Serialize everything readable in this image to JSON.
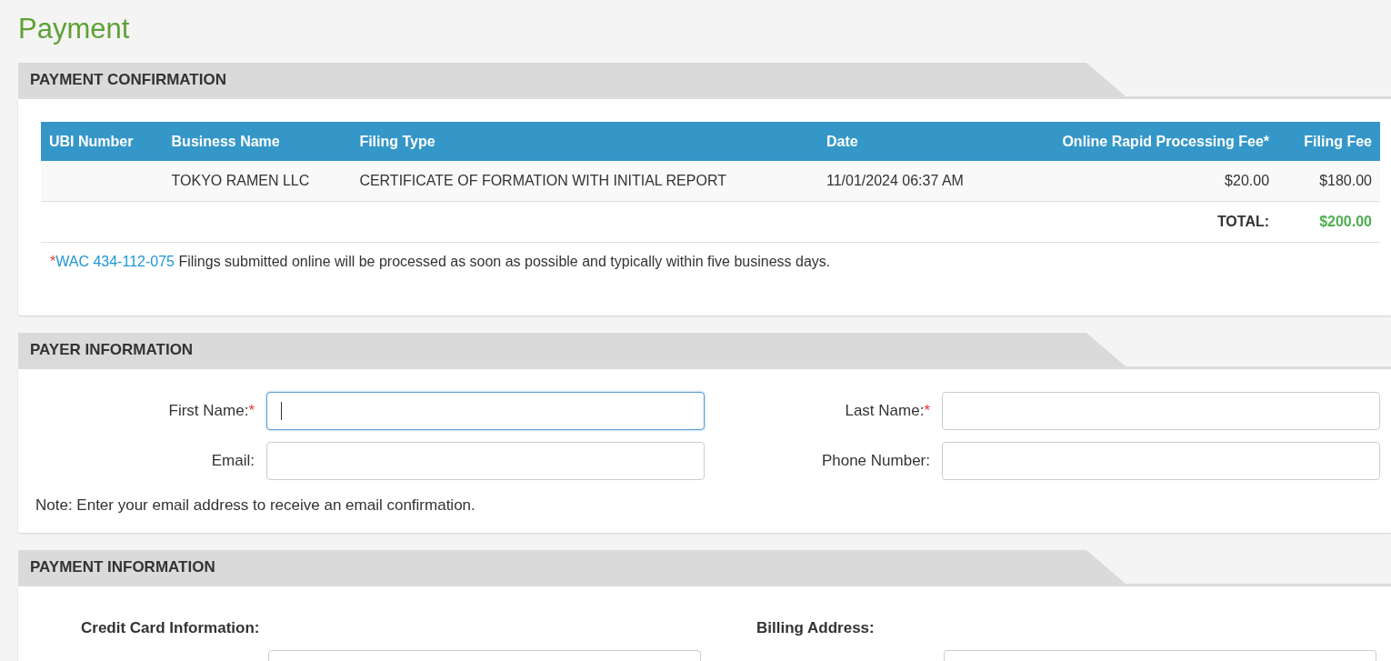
{
  "page_title": "Payment",
  "confirmation": {
    "title": "PAYMENT CONFIRMATION",
    "columns": [
      "UBI Number",
      "Business Name",
      "Filing Type",
      "Date",
      "Online Rapid Processing Fee*",
      "Filing Fee"
    ],
    "rows": [
      [
        "",
        "TOKYO RAMEN LLC",
        "CERTIFICATE OF FORMATION WITH INITIAL REPORT",
        "11/01/2024 06:37 AM",
        "$20.00",
        "$180.00"
      ]
    ],
    "total_label": "TOTAL:",
    "total_value": "$200.00",
    "footnote": {
      "mark": "*",
      "link": "WAC 434-112-075",
      "text": " Filings submitted online will be processed as soon as possible and typically within five business days."
    }
  },
  "payer": {
    "title": "PAYER INFORMATION",
    "fields": [
      {
        "label": "First Name:",
        "required_mark": "*",
        "focused": true
      },
      {
        "label": "Last Name:",
        "required_mark": "*",
        "focused": false
      },
      {
        "label": "Email:",
        "focused": false
      },
      {
        "label": "Phone Number:",
        "focused": false
      }
    ],
    "note": "Note: Enter your email address to receive an email confirmation."
  },
  "payment": {
    "title": "PAYMENT INFORMATION",
    "subheadings": [
      "Credit Card Information:",
      "Billing Address:"
    ]
  }
}
